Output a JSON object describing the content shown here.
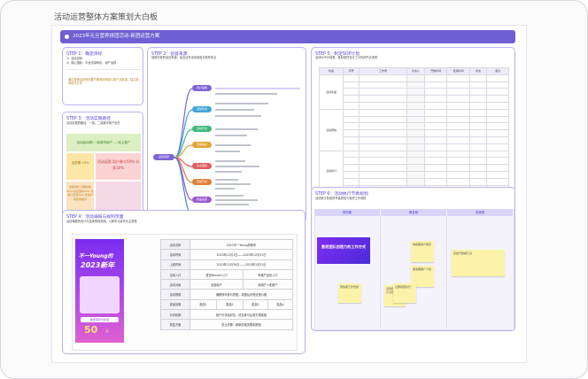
{
  "page": {
    "title": "活动运营整体方案策划大白板"
  },
  "board": {
    "header": "2023年元旦营养拼团活动·新团运营方案"
  },
  "step1": {
    "title": "STEP 1：确定目标",
    "items": [
      "1）活动目标：",
      "2）核心指标：平台流量转化、用户活跃"
    ],
    "summary": "通过营销活动带动春节期间的销量与用户活跃度，建立新的增长方式"
  },
  "step2": {
    "title": "STEP 2：创意来源",
    "intro": "营销方案的创意来源，结合往年活动经验与新年热点",
    "center": "活动创意",
    "branch_labels": [
      "用户画像",
      "活动形式",
      "活动玩法",
      "传播渠道",
      "热点借势",
      "营销节点",
      "奖品设置",
      "执行计划"
    ]
  },
  "step3": {
    "title": "STEP 3：活动实施路径",
    "desc": "活动实施的路径：一线、二线城市用户优先",
    "blocks": [
      "活动启动期 一线城市用户 — 线上推广",
      "活跃期 10%",
      "活动运营 用户参与50% 分享10%",
      "裂变增长 社群拉新50% 好友邀请30% 老用户召回10% 新用户转化率提升"
    ]
  },
  "step4": {
    "title": "STEP 4：活动海报与规则页面",
    "desc": "活动海报的设计与具体规则页面，以新年元素作为主视觉",
    "poster": {
      "line1": "不一Young的",
      "line2": "2023新年",
      "badge": "新年营养大礼包",
      "offer": "50",
      "offer_unit": "元"
    },
    "form_rows": [
      {
        "label": "活动名称",
        "cells": [
          "2023不一Young的新年"
        ]
      },
      {
        "label": "活动时间",
        "cells": [
          "2023年12月1日——2023年12月31日"
        ]
      },
      {
        "label": "上线时间",
        "cells": [
          "2023年12月30日——2023年1月31日"
        ]
      },
      {
        "label": "活动入口",
        "cells": [
          "首页Banner入口",
          "商城产品页入口"
        ]
      },
      {
        "label": "活动对象",
        "cells": [
          "全部用户",
          "新用户+老用户"
        ]
      },
      {
        "label": "活动规则",
        "cells": [
          "满额即可参与拼团，成团后享受优惠价格"
        ]
      },
      {
        "label": "奖品设置",
        "cells": [
          "奖品1",
          "奖品2",
          "奖品3",
          "奖品4"
        ]
      },
      {
        "label": "分享机制",
        "cells": [
          "用户分享给好友，好友参与后双方得奖励"
        ]
      },
      {
        "label": "风控方案",
        "cells": [
          "防止作弊、刷单的相关限制规则"
        ]
      }
    ]
  },
  "step5": {
    "title": "STEP 5：制定SOP计划",
    "desc": "活动SOP计划表，各阶段任务分工与时间节点安排",
    "columns": [
      "阶段",
      "序号",
      "工作项",
      "负责人",
      "开始时间",
      "结束时间",
      "状态",
      "备注"
    ],
    "phase_labels": [
      "活动筹备",
      "活动预热",
      "活动执行",
      "活动收尾"
    ],
    "row_count": 22
  },
  "step6": {
    "title": "STEP 6：活动执行节奏规划",
    "desc": "活动执行阶段的节奏把控与各项工作安排",
    "columns": [
      "预热期",
      "爆发期",
      "收尾期"
    ],
    "poster_text": "激发团队创造力的工作方式",
    "notes": [
      "预热期工作安排",
      "活动预告与用户召回",
      "爆发期推广计划",
      "社群裂变执行",
      "复盘与数据汇总",
      "收尾期用户留存"
    ]
  },
  "colors": {
    "accent": "#6f5fd4",
    "card_border": "#b9b2f0",
    "note": "#fbf3a8"
  }
}
